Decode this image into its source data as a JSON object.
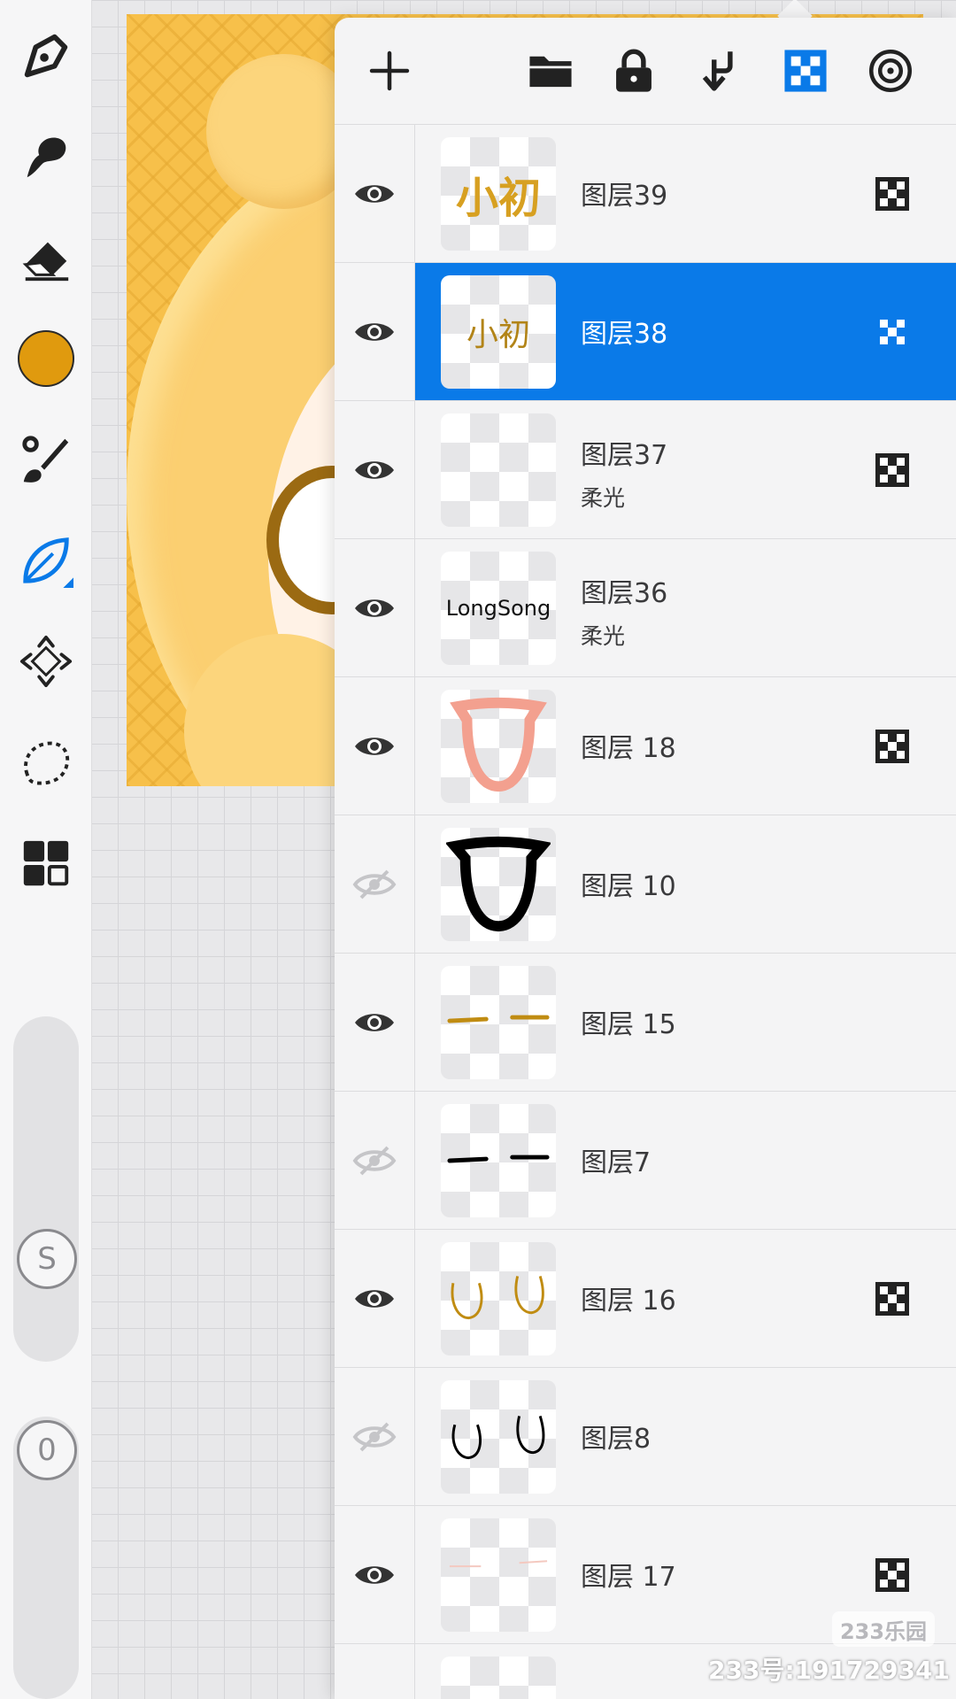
{
  "app": {
    "accent_color": "#0a7ae8",
    "current_color": "#e09a0e"
  },
  "toolbar": {
    "tools": [
      {
        "name": "pen-icon"
      },
      {
        "name": "smudge-icon"
      },
      {
        "name": "eraser-icon"
      },
      {
        "name": "color-swatch"
      },
      {
        "name": "brush-settings-icon"
      },
      {
        "name": "leaf-brush-icon"
      },
      {
        "name": "move-icon"
      },
      {
        "name": "lasso-icon"
      },
      {
        "name": "layers-icon"
      }
    ],
    "size_slider_label": "S",
    "opacity_slider_label": "0"
  },
  "layer_panel": {
    "header_buttons": [
      "add-layer-icon",
      "folder-icon",
      "lock-icon",
      "merge-down-icon",
      "alpha-lock-icon",
      "reference-icon"
    ],
    "layers": [
      {
        "name": "图层39",
        "blend": "",
        "visible": true,
        "alpha_locked": true,
        "selected": false
      },
      {
        "name": "图层38",
        "blend": "",
        "visible": true,
        "alpha_locked": true,
        "selected": true
      },
      {
        "name": "图层37",
        "blend": "柔光",
        "visible": true,
        "alpha_locked": true,
        "selected": false
      },
      {
        "name": "图层36",
        "blend": "柔光",
        "visible": true,
        "alpha_locked": false,
        "selected": false
      },
      {
        "name": "图层 18",
        "blend": "",
        "visible": true,
        "alpha_locked": true,
        "selected": false
      },
      {
        "name": "图层 10",
        "blend": "",
        "visible": false,
        "alpha_locked": false,
        "selected": false
      },
      {
        "name": "图层 15",
        "blend": "",
        "visible": true,
        "alpha_locked": false,
        "selected": false
      },
      {
        "name": "图层7",
        "blend": "",
        "visible": false,
        "alpha_locked": false,
        "selected": false
      },
      {
        "name": "图层 16",
        "blend": "",
        "visible": true,
        "alpha_locked": true,
        "selected": false
      },
      {
        "name": "图层8",
        "blend": "",
        "visible": false,
        "alpha_locked": false,
        "selected": false
      },
      {
        "name": "图层 17",
        "blend": "",
        "visible": true,
        "alpha_locked": true,
        "selected": false
      }
    ],
    "thumbnail_texts": {
      "layer39": "小初",
      "layer38": "小初",
      "layer36": "LongSong"
    }
  },
  "watermark": {
    "logo": "233乐园",
    "text": "233号:191729341"
  }
}
